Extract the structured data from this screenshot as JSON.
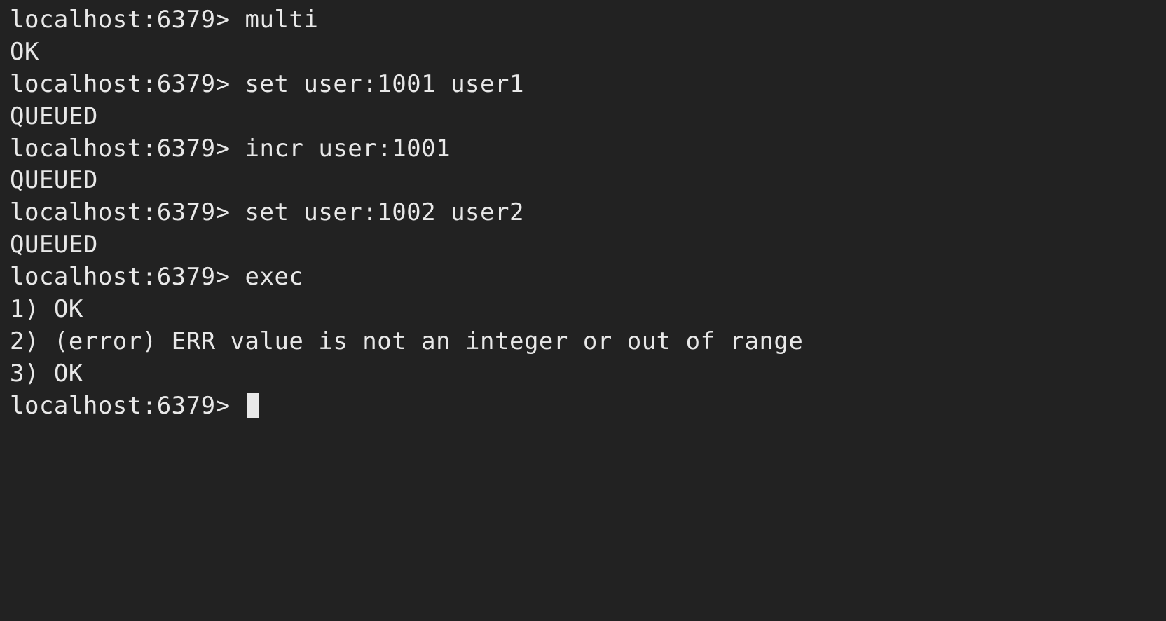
{
  "prompt": "localhost:6379> ",
  "session": [
    {
      "type": "cmd",
      "text": "multi"
    },
    {
      "type": "out",
      "text": "OK"
    },
    {
      "type": "cmd",
      "text": "set user:1001 user1"
    },
    {
      "type": "out",
      "text": "QUEUED"
    },
    {
      "type": "cmd",
      "text": "incr user:1001"
    },
    {
      "type": "out",
      "text": "QUEUED"
    },
    {
      "type": "cmd",
      "text": "set user:1002 user2"
    },
    {
      "type": "out",
      "text": "QUEUED"
    },
    {
      "type": "cmd",
      "text": "exec"
    },
    {
      "type": "out",
      "text": "1) OK"
    },
    {
      "type": "out",
      "text": "2) (error) ERR value is not an integer or out of range"
    },
    {
      "type": "out",
      "text": "3) OK"
    }
  ]
}
